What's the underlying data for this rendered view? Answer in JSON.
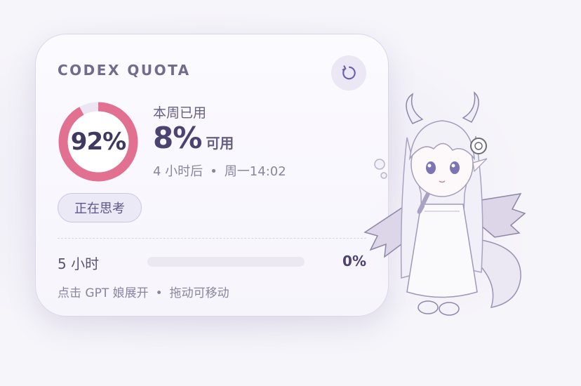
{
  "widget": {
    "title": "CODEX QUOTA",
    "refresh_icon": "refresh-icon",
    "weekly": {
      "used_percent_label": "92%",
      "used_fraction": 0.92,
      "period_label": "本周已用",
      "available_percent": "8%",
      "available_suffix": "可用",
      "reset_relative": "4 小时后",
      "separator": "•",
      "reset_time": "周一14:02"
    },
    "status_badge": "正在思考",
    "short_window": {
      "label": "5 小时",
      "percent_label": "0%",
      "fraction": 0
    },
    "footer": {
      "hint_click": "点击 GPT 娘展开",
      "separator": "•",
      "hint_drag": "拖动可移动"
    }
  },
  "colors": {
    "ring_used": "#e27091",
    "ring_track": "#ece6f4",
    "accent": "#4b4470",
    "refresh_bg": "#ebe7f5",
    "badge_bg": "#ece9f7"
  },
  "mascot": {
    "icon": "dragon-girl-mascot-illustration"
  }
}
